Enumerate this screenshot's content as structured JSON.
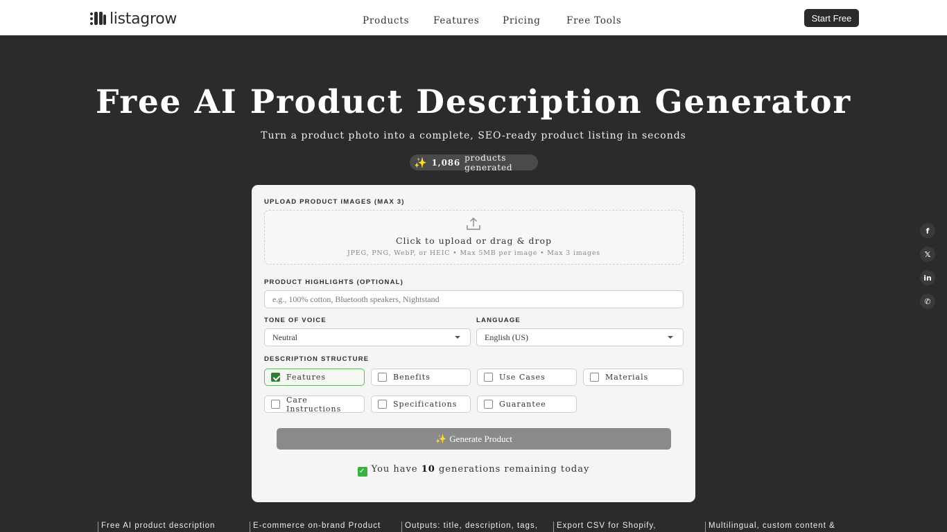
{
  "header": {
    "logo_text": "listagrow",
    "nav": [
      "Products",
      "Features",
      "Pricing",
      "Free Tools"
    ],
    "cta": "Start Free"
  },
  "hero": {
    "title": "Free AI Product Description Generator",
    "subtitle": "Turn a product photo into a complete, SEO-ready product listing in seconds",
    "counter_icon": "✨",
    "counter_value": "1,086",
    "counter_text": "products generated"
  },
  "form": {
    "upload_label": "UPLOAD PRODUCT IMAGES (MAX 3)",
    "upload_icon": "upload-icon",
    "upload_main": "Click to upload or drag & drop",
    "upload_sub": "JPEG, PNG, WebP, or HEIC • Max 5MB per image • Max 3 images",
    "highlights_label": "PRODUCT HIGHLIGHTS (OPTIONAL)",
    "highlights_placeholder": "e.g., 100% cotton, Bluetooth speakers, Nightstand",
    "tone_label": "TONE OF VOICE",
    "tone_value": "Neutral",
    "language_label": "LANGUAGE",
    "language_value": "English (US)",
    "structure_label": "DESCRIPTION STRUCTURE",
    "structure_options": [
      {
        "label": "Features",
        "checked": true
      },
      {
        "label": "Benefits",
        "checked": false
      },
      {
        "label": "Use Cases",
        "checked": false
      },
      {
        "label": "Materials",
        "checked": false
      },
      {
        "label": "Care Instructions",
        "checked": false
      },
      {
        "label": "Specifications",
        "checked": false
      },
      {
        "label": "Guarantee",
        "checked": false
      }
    ],
    "generate_icon": "✨",
    "generate_label": "Generate Product",
    "remaining_prefix": "You have",
    "remaining_count": "10",
    "remaining_suffix": "generations remaining today"
  },
  "social": [
    {
      "icon": "facebook-icon",
      "glyph": "f"
    },
    {
      "icon": "x-icon",
      "glyph": "𝕏"
    },
    {
      "icon": "linkedin-icon",
      "glyph": "in"
    },
    {
      "icon": "whatsapp-icon",
      "glyph": "✆"
    }
  ],
  "features_strip": [
    "Free AI product description",
    "E-commerce on-brand Product",
    "Outputs: title, description, tags,",
    "Export CSV for Shopify,",
    "Multilingual, custom content &"
  ],
  "colors": {
    "background": "#2b2b2b",
    "card": "#f5f5f5",
    "button_disabled": "#8a8a8a",
    "checkbox_active": "#2e7d32"
  }
}
